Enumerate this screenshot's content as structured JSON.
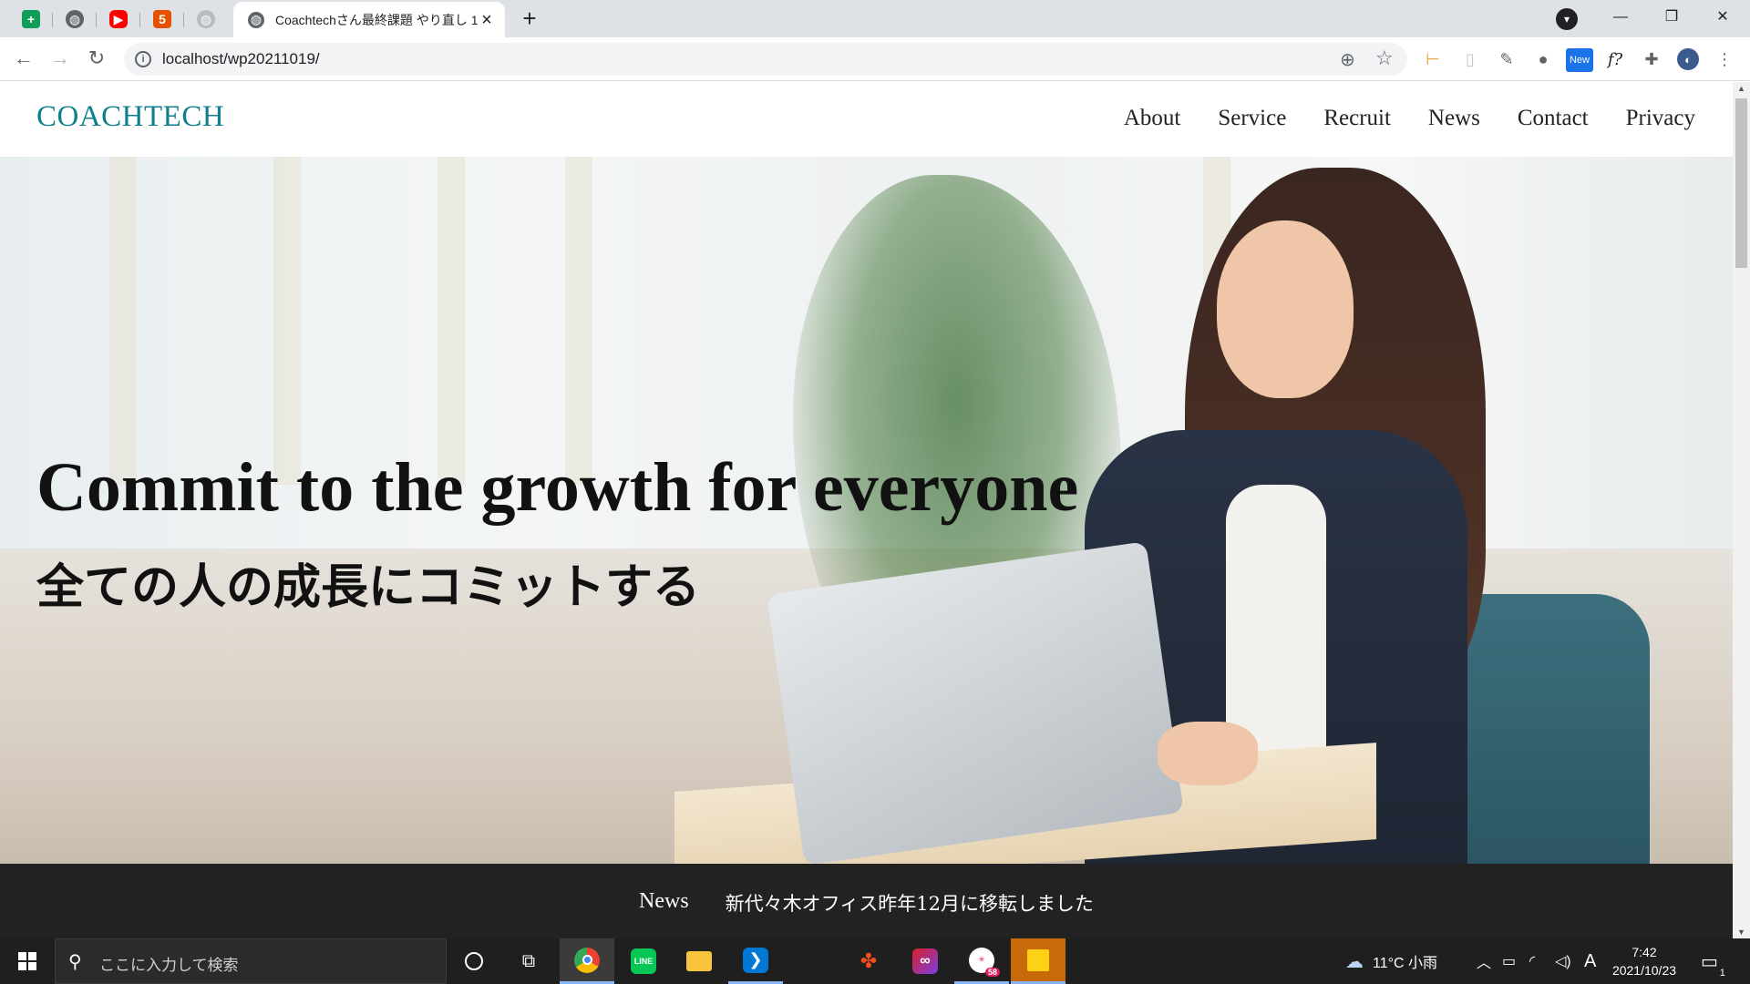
{
  "browser": {
    "active_tab_title": "Coachtechさん最終課題 やり直し 1",
    "url": "localhost/wp20211019/",
    "new_ext_badge": "New",
    "formula_ext_label": "f?"
  },
  "site": {
    "logo": "COACHTECH",
    "nav": [
      "About",
      "Service",
      "Recruit",
      "News",
      "Contact",
      "Privacy"
    ],
    "hero_title_en": "Commit to the growth for everyone",
    "hero_title_jp": "全ての人の成長にコミットする",
    "news_label": "News",
    "news_text": "新代々木オフィス昨年12月に移転しました"
  },
  "taskbar": {
    "search_placeholder": "ここに入力して検索",
    "weather": "11°C 小雨",
    "ime": "A",
    "time": "7:42",
    "date": "2021/10/23",
    "notification_count": "1",
    "app_badge": "58"
  },
  "colors": {
    "logo": "#0f7f8c",
    "news_bar": "#222222",
    "tab_bar": "#dee1e6",
    "taskbar": "#1f1f1f"
  }
}
